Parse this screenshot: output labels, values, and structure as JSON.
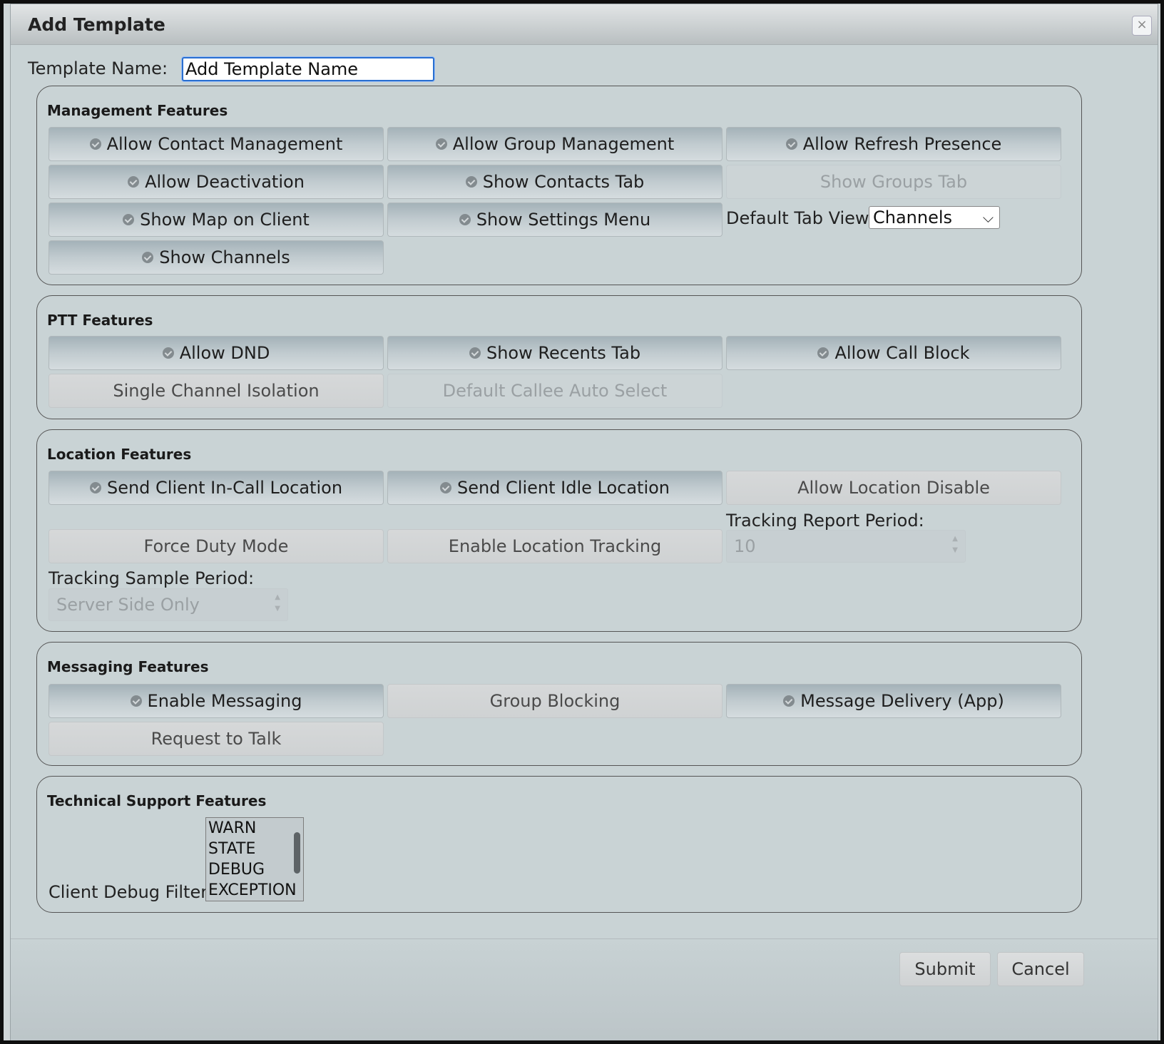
{
  "dialog": {
    "title": "Add Template",
    "close_symbol": "×",
    "template_name_label": "Template Name:",
    "template_name_value": "Add Template Name"
  },
  "management": {
    "title": "Management Features",
    "buttons": [
      {
        "label": "Allow Contact Management",
        "checked": true
      },
      {
        "label": "Allow Group Management",
        "checked": true
      },
      {
        "label": "Allow Refresh Presence",
        "checked": true
      },
      {
        "label": "Allow Deactivation",
        "checked": true
      },
      {
        "label": "Show Contacts Tab",
        "checked": true
      },
      {
        "label": "Show Groups Tab",
        "checked": false,
        "disabled": true
      },
      {
        "label": "Show Map on Client",
        "checked": true
      },
      {
        "label": "Show Settings Menu",
        "checked": true
      },
      {
        "label": "Show Channels",
        "checked": true
      }
    ],
    "default_tab_label": "Default Tab View:",
    "default_tab_value": "Channels"
  },
  "ptt": {
    "title": "PTT Features",
    "buttons": [
      {
        "label": "Allow DND",
        "checked": true
      },
      {
        "label": "Show Recents Tab",
        "checked": true
      },
      {
        "label": "Allow Call Block",
        "checked": true
      },
      {
        "label": "Single Channel Isolation",
        "checked": false
      },
      {
        "label": "Default Callee Auto Select",
        "checked": false,
        "disabled": true
      }
    ]
  },
  "location": {
    "title": "Location Features",
    "buttons": [
      {
        "label": "Send Client In-Call Location",
        "checked": true
      },
      {
        "label": "Send Client Idle Location",
        "checked": true
      },
      {
        "label": "Allow Location Disable",
        "checked": false
      },
      {
        "label": "Force Duty Mode",
        "checked": false
      },
      {
        "label": "Enable Location Tracking",
        "checked": false
      }
    ],
    "tracking_report_label": "Tracking Report Period:",
    "tracking_report_value": "10",
    "tracking_sample_label": "Tracking Sample Period:",
    "tracking_sample_value": "Server Side Only"
  },
  "messaging": {
    "title": "Messaging Features",
    "buttons": [
      {
        "label": "Enable Messaging",
        "checked": true
      },
      {
        "label": "Group Blocking",
        "checked": false
      },
      {
        "label": "Message Delivery (App)",
        "checked": true
      },
      {
        "label": "Request to Talk",
        "checked": false
      }
    ]
  },
  "support": {
    "title": "Technical Support Features",
    "debug_filter_label": "Client Debug Filter:",
    "debug_options": [
      "WARN",
      "STATE",
      "DEBUG",
      "EXCEPTION"
    ]
  },
  "footer": {
    "submit_label": "Submit",
    "cancel_label": "Cancel"
  }
}
